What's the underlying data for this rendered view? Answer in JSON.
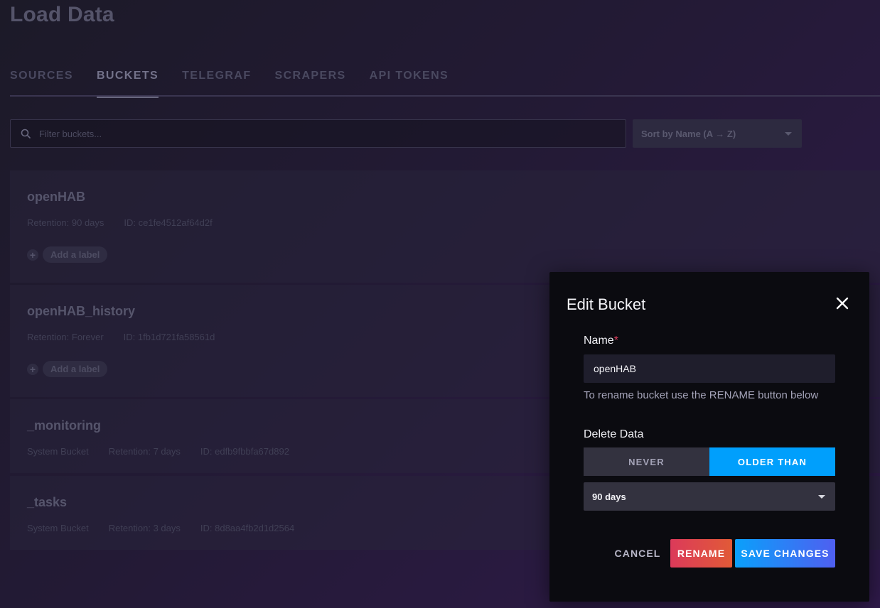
{
  "page": {
    "title": "Load Data"
  },
  "tabs": [
    {
      "label": "SOURCES",
      "active": false
    },
    {
      "label": "BUCKETS",
      "active": true
    },
    {
      "label": "TELEGRAF",
      "active": false
    },
    {
      "label": "SCRAPERS",
      "active": false
    },
    {
      "label": "API TOKENS",
      "active": false
    }
  ],
  "filter": {
    "placeholder": "Filter buckets...",
    "icon": "search-icon"
  },
  "sort": {
    "label": "Sort by Name (A → Z)",
    "icon": "chevron-down-icon"
  },
  "buckets": [
    {
      "name": "openHAB",
      "retention": "Retention: 90 days",
      "id": "ID: ce1fe4512af64d2f",
      "add_label": "Add a label"
    },
    {
      "name": "openHAB_history",
      "retention": "Retention: Forever",
      "id": "ID: 1fb1d721fa58561d",
      "add_label": "Add a label"
    },
    {
      "name": "_monitoring",
      "system": "System Bucket",
      "retention": "Retention: 7 days",
      "id": "ID: edfb9fbbfa67d892"
    },
    {
      "name": "_tasks",
      "system": "System Bucket",
      "retention": "Retention: 3 days",
      "id": "ID: 8d8aa4fb2d1d2564"
    }
  ],
  "modal": {
    "title": "Edit Bucket",
    "name_label": "Name",
    "required_mark": "*",
    "name_value": "openHAB",
    "help_text": "To rename bucket use the RENAME button below",
    "delete_label": "Delete Data",
    "toggle": {
      "never": "NEVER",
      "older_than": "OLDER THAN",
      "selected": "older_than"
    },
    "retention_select": "90 days",
    "buttons": {
      "cancel": "CANCEL",
      "rename": "RENAME",
      "save": "SAVE CHANGES"
    }
  },
  "colors": {
    "accent_blue": "#009ffc",
    "rename_red": "#dc3a5a",
    "required_red": "#e0405e"
  }
}
